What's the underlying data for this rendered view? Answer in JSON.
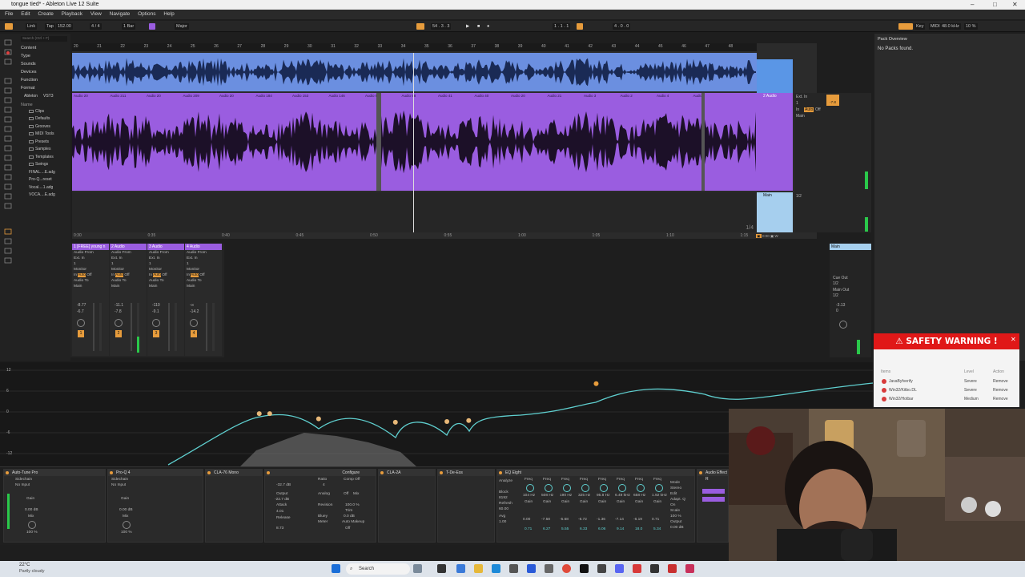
{
  "window": {
    "title": "tongue tied* - Ableton Live 12 Suite"
  },
  "menu": [
    "File",
    "Edit",
    "Create",
    "Playback",
    "View",
    "Navigate",
    "Options",
    "Help"
  ],
  "transport": {
    "link": "Link",
    "tap": "Tap",
    "tempo": "152.00",
    "signature": "4 / 4",
    "quantize": "1 Bar",
    "key_label": "Major",
    "position": "54 . 3 . 3",
    "loop_start": "1 . 1 . 1",
    "loop_len": "4 . 0 . 0",
    "key": "Key",
    "midi": "MIDI",
    "sample_rate": "48.0 kHz",
    "cpu": "10 %"
  },
  "browser": {
    "search": "Search (Ctrl + F)",
    "categories": [
      "Content",
      "Type",
      "Sounds",
      "Devices",
      "Function",
      "Format",
      "Ableton",
      "VST3"
    ],
    "places_label": "Name",
    "folders": [
      "Clips",
      "Defaults",
      "Grooves",
      "MIDI Tools",
      "Presets",
      "Samples",
      "Templates",
      "Swings"
    ],
    "files": [
      "FINAL....E.adg",
      "Pro-Q...reset",
      "Vocal....1.adg",
      "VOCA....E.adg"
    ]
  },
  "ruler": [
    "20",
    "21",
    "22",
    "23",
    "24",
    "25",
    "26",
    "27",
    "28",
    "29",
    "30",
    "31",
    "32",
    "33",
    "34",
    "35",
    "36",
    "37",
    "38",
    "39",
    "40",
    "41",
    "42",
    "43",
    "44",
    "45",
    "46",
    "47",
    "48"
  ],
  "clips": [
    "Audio 20",
    "Audio 211",
    "Audio 20",
    "Audio 209",
    "Audio 20",
    "Audio 184",
    "Audio 153",
    "Audio 146",
    "Audio 61",
    "Audio 68",
    "Audio 41",
    "Audio 40",
    "Audio 20",
    "Audio 21",
    "Audio 3",
    "Audio 2",
    "Audio 4",
    "Audio"
  ],
  "time_axis": [
    "0:30",
    "0:35",
    "0:40",
    "0:45",
    "0:50",
    "0:55",
    "1:00",
    "1:05",
    "1:10",
    "1:15"
  ],
  "loop_fraction": "1/4",
  "tracks": {
    "audio_track_name": "2 Audio",
    "main_track_name": "Main",
    "io_ext_in": "Ext. In",
    "io_channel": "1",
    "io_in": "In",
    "io_auto": "Auto",
    "io_off": "Off",
    "io_main": "Main",
    "io_half": "1/2",
    "io_value": "-7.8"
  },
  "session_channels": [
    {
      "name": "1 [FREE] young n",
      "vol": "-8.77",
      "pan": "-6.7",
      "num": "1"
    },
    {
      "name": "2 Audio",
      "vol": "-11.1",
      "pan": "-7.8",
      "num": "2"
    },
    {
      "name": "3 Audio",
      "vol": "-110",
      "pan": "-9.1",
      "num": "3"
    },
    {
      "name": "4 Audio",
      "vol": "-∞",
      "pan": "-14.2",
      "num": "4"
    }
  ],
  "channel_labels": {
    "audio_from": "Audio From",
    "ext_in": "Ext. In",
    "ch1": "1",
    "monitor": "Monitor",
    "in": "In",
    "auto": "Auto",
    "off": "Off",
    "audio_to": "Audio To",
    "main": "Main"
  },
  "main_strip": {
    "name": "Main",
    "cue_out": "Cue Out",
    "cue_val": "1/2",
    "main_out": "Main Out",
    "main_val": "1/2",
    "vol": "-3.13",
    "pan": "0"
  },
  "eq_axis": [
    "12",
    "6",
    "0",
    "-6",
    "-12"
  ],
  "eq_points": [
    {
      "freq_frac": 0.297,
      "gain_db": -0.5
    },
    {
      "freq_frac": 0.309,
      "gain_db": -0.5
    },
    {
      "freq_frac": 0.365,
      "gain_db": -2.0
    },
    {
      "freq_frac": 0.453,
      "gain_db": -3.0
    },
    {
      "freq_frac": 0.512,
      "gain_db": -2.8
    },
    {
      "freq_frac": 0.537,
      "gain_db": -2.5
    },
    {
      "freq_frac": 0.683,
      "gain_db": 8.2
    }
  ],
  "devices": [
    {
      "name": "Auto-Tune Pro",
      "labels": [
        "Sidechain",
        "No Input",
        "Gain",
        "0.00 dB",
        "Mix",
        "100 %"
      ]
    },
    {
      "name": "Pro-Q 4",
      "labels": [
        "Sidechain",
        "No Input",
        "Gain",
        "0.00 dB",
        "Mix",
        "100 %"
      ]
    },
    {
      "name": "CLA-76 Mono",
      "labels": []
    },
    {
      "name": "Configure",
      "labels": [
        "Input",
        "-32.7 dB",
        "Ratio",
        "4",
        "Comp Off",
        "Output",
        "-22.7 dB",
        "Analog",
        "Off",
        "Mix",
        "Attack",
        "100.0 %",
        "4.01",
        "Revision",
        "Trim",
        "Release",
        "0.0 dB",
        "Bluey",
        "Auto Makeup",
        "8.73",
        "Meter",
        "Off"
      ]
    },
    {
      "name": "CLA-2A",
      "labels": []
    },
    {
      "name": "T-De-Ess",
      "labels": []
    },
    {
      "name": "EQ Eight",
      "labels": [
        "Analyze",
        "Block",
        "8192",
        "Refresh",
        "60.00",
        "Avg",
        "1.00",
        "Mode",
        "Stereo",
        "Edit",
        "Adapt. Q",
        "On",
        "Scale",
        "100 %",
        "Output",
        "0.00 dB"
      ]
    },
    {
      "name": "Audio Effect R",
      "labels": []
    }
  ],
  "eq8_bands": [
    {
      "freq": "104 Hz",
      "gain": "0.00",
      "q": "0.71"
    },
    {
      "freq": "508 Hz",
      "gain": "-7.58",
      "q": "6.27"
    },
    {
      "freq": "190 Hz",
      "gain": "-5.68",
      "q": "5.55"
    },
    {
      "freq": "325 Hz",
      "gain": "-6.72",
      "q": "6.33"
    },
    {
      "freq": "95.8 Hz",
      "gain": "-1.36",
      "q": "6.06"
    },
    {
      "freq": "6.49 kHz",
      "gain": "-7.14",
      "q": "9.14"
    },
    {
      "freq": "658 Hz",
      "gain": "-6.19",
      "q": "18.0"
    },
    {
      "freq": "1.92 kHz",
      "gain": "0.71",
      "q": "5.34"
    }
  ],
  "pack_panel": {
    "title": "Pack Overview",
    "message": "No Packs found."
  },
  "warning": {
    "title": "⚠ SAFETY WARNING !",
    "cols": [
      "Items",
      "Level",
      "Action"
    ],
    "rows": [
      {
        "name": "JavaByfverify",
        "level": "Severe",
        "action": "Remove"
      },
      {
        "name": "Win32/Kitbo.DL",
        "level": "Severe",
        "action": "Remove"
      },
      {
        "name": "Win32/Hotbar",
        "level": "Medium",
        "action": "Remove"
      }
    ]
  },
  "taskbar": {
    "weather_temp": "22°C",
    "weather_desc": "Partly cloudy",
    "search": "Search"
  },
  "colors": {
    "purple": "#9a5de0",
    "blue": "#6b8fe0",
    "orange": "#e79c3c",
    "eq_curve": "#5fcfcf",
    "warning": "#e01818"
  }
}
